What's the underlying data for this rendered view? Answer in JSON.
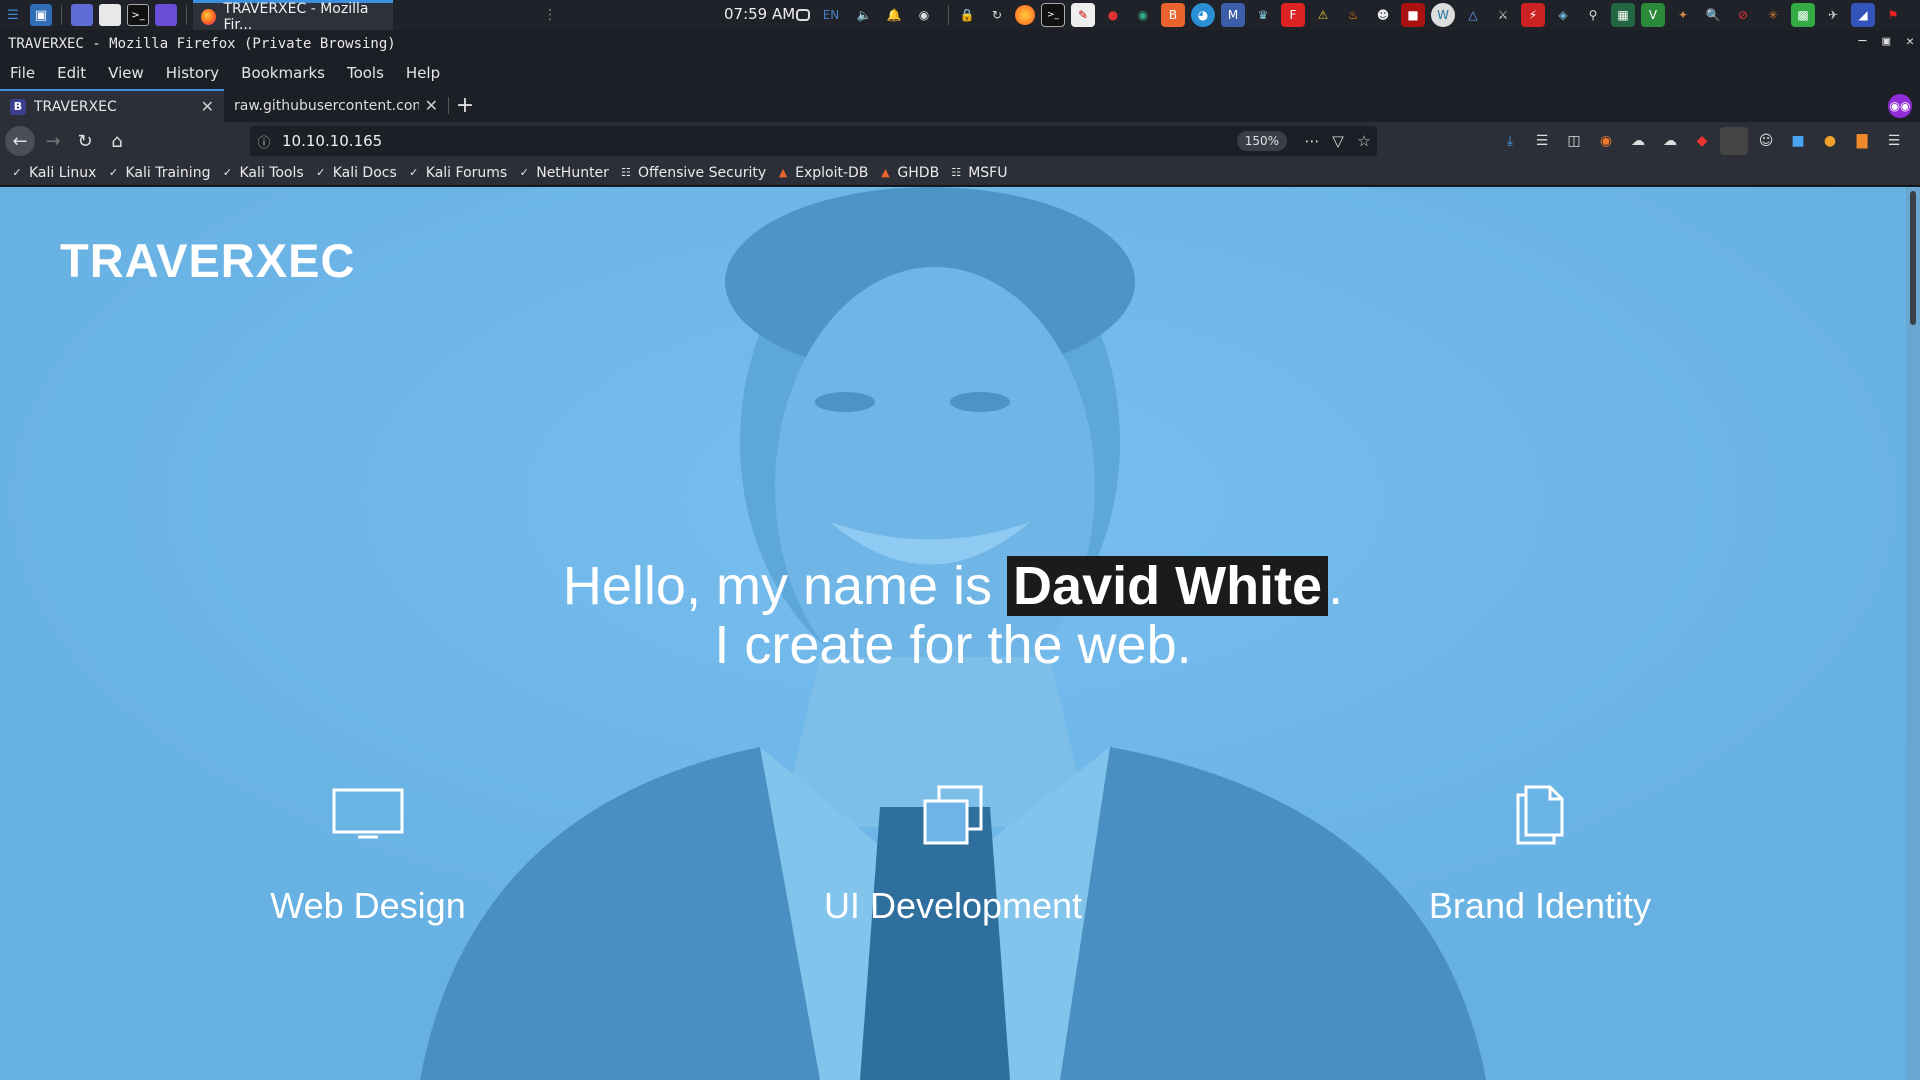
{
  "taskbar": {
    "active_task": "TRAVERXEC - Mozilla Fir...",
    "clock": "07:59 AM",
    "keyboard_layout": "EN"
  },
  "window": {
    "title": "TRAVERXEC - Mozilla Firefox (Private Browsing)"
  },
  "menubar": {
    "items": [
      "File",
      "Edit",
      "View",
      "History",
      "Bookmarks",
      "Tools",
      "Help"
    ]
  },
  "tabs": [
    {
      "label": "TRAVERXEC",
      "favicon": "B",
      "active": true
    },
    {
      "label": "raw.githubusercontent.com/",
      "active": false
    }
  ],
  "navbar": {
    "url": "10.10.10.165",
    "zoom": "150%"
  },
  "bookmarks": [
    {
      "label": "Kali Linux",
      "icon": "kali-dragon-icon"
    },
    {
      "label": "Kali Training",
      "icon": "kali-dragon-icon"
    },
    {
      "label": "Kali Tools",
      "icon": "kali-dragon-icon"
    },
    {
      "label": "Kali Docs",
      "icon": "kali-dragon-icon"
    },
    {
      "label": "Kali Forums",
      "icon": "kali-dragon-icon"
    },
    {
      "label": "NetHunter",
      "icon": "kali-dragon-icon"
    },
    {
      "label": "Offensive Security",
      "icon": "offsec-icon"
    },
    {
      "label": "Exploit-DB",
      "icon": "exploitdb-icon"
    },
    {
      "label": "GHDB",
      "icon": "exploitdb-icon"
    },
    {
      "label": "MSFU",
      "icon": "offsec-icon"
    }
  ],
  "page": {
    "logo": "TRAVERXEC",
    "hero": {
      "prefix": "Hello, my name is ",
      "name": "David White",
      "suffix": ".",
      "line2": "I create for the web."
    },
    "services": [
      {
        "title": "Web Design",
        "icon": "monitor-icon"
      },
      {
        "title": "UI Development",
        "icon": "windows-stack-icon"
      },
      {
        "title": "Brand Identity",
        "icon": "document-icon"
      }
    ],
    "colors": {
      "overlay": "#6cb5e6",
      "highlight_bg": "#1b1b1d",
      "text": "#ffffff"
    }
  }
}
